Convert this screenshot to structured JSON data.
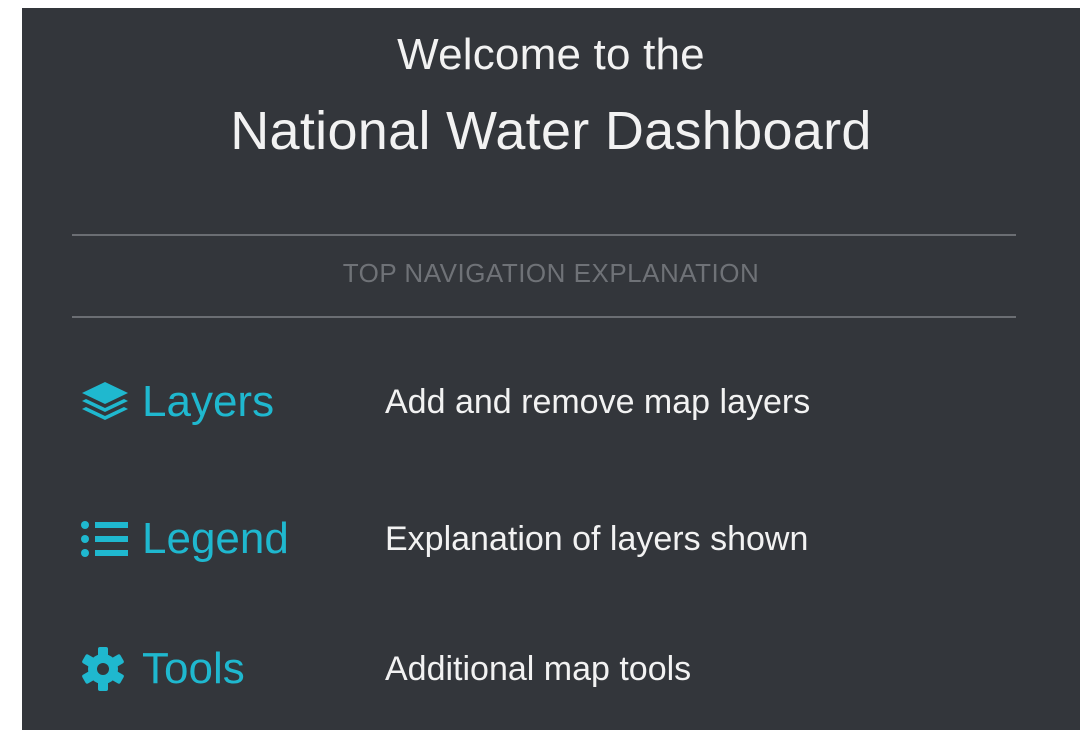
{
  "welcome": {
    "line1": "Welcome to the",
    "line2": "National Water Dashboard"
  },
  "section_header": "TOP NAVIGATION EXPLANATION",
  "nav_items": [
    {
      "icon": "layers-icon",
      "label": "Layers",
      "description": "Add and remove map layers"
    },
    {
      "icon": "list-icon",
      "label": "Legend",
      "description": "Explanation of layers shown"
    },
    {
      "icon": "gear-icon",
      "label": "Tools",
      "description": "Additional map tools"
    }
  ],
  "colors": {
    "panel_background": "#33363b",
    "accent": "#1fb8cf",
    "text": "#f2f2f2",
    "muted_text": "#6f7277",
    "divider": "#6b6e73"
  }
}
